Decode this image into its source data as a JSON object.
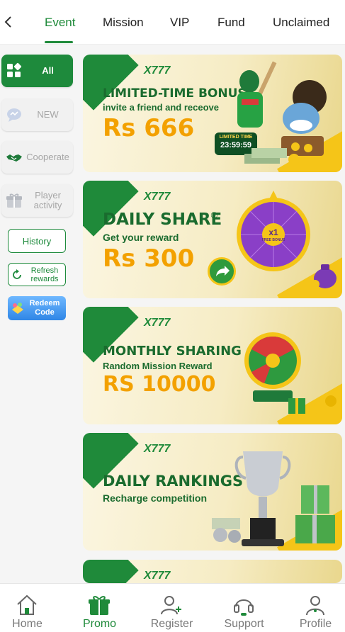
{
  "tabs": [
    {
      "label": "Event",
      "active": true
    },
    {
      "label": "Mission"
    },
    {
      "label": "VIP"
    },
    {
      "label": "Fund"
    },
    {
      "label": "Unclaimed"
    }
  ],
  "sidebar": {
    "categories": [
      {
        "label": "All",
        "icon": "grid-icon",
        "active": true
      },
      {
        "label": "NEW",
        "icon": "chat-bubble-icon"
      },
      {
        "label": "Cooperate",
        "icon": "handshake-icon"
      },
      {
        "label": "Player activity",
        "icon": "gift-box-icon"
      }
    ],
    "history": "History",
    "refresh": "Refresh rewards",
    "redeem": "Redeem Code"
  },
  "banners": [
    {
      "logo": "X777",
      "title": "LIMITED-TIME BONUS",
      "subtitle": "invite a friend and receove",
      "amount": "Rs 666",
      "badge_title": "LIMITED TIME",
      "badge_time": "23:59:59"
    },
    {
      "logo": "X777",
      "title": "DAILY SHARE",
      "marker": "④",
      "subtitle": "Get your reward",
      "amount": "Rs 300",
      "wheel_center": "x1",
      "wheel_center_sub": "FREE BONUS"
    },
    {
      "logo": "X777",
      "title": "MONTHLY SHARING",
      "subtitle": "Random Mission Reward",
      "amount": "RS 10000"
    },
    {
      "logo": "X777",
      "title": "DAILY RANKINGS",
      "subtitle": "Recharge competition"
    },
    {
      "logo": "X777"
    }
  ],
  "bottom_nav": [
    {
      "label": "Home",
      "icon": "home-icon"
    },
    {
      "label": "Promo",
      "icon": "gift-icon",
      "active": true
    },
    {
      "label": "Register",
      "icon": "add-user-icon"
    },
    {
      "label": "Support",
      "icon": "headset-icon"
    },
    {
      "label": "Profile",
      "icon": "profile-icon"
    }
  ],
  "colors": {
    "accent": "#1f8a3a",
    "gold": "#f3a100",
    "yellow": "#f5c518"
  }
}
